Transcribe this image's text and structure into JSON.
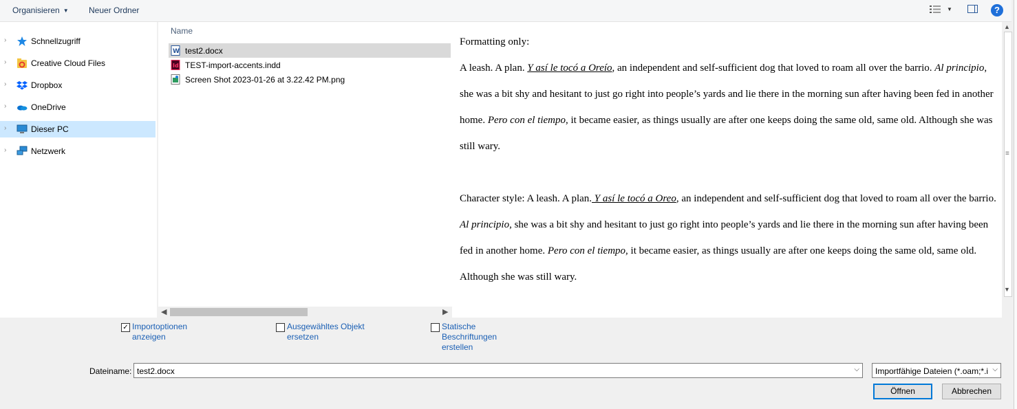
{
  "toolbar": {
    "organize_label": "Organisieren",
    "new_folder_label": "Neuer Ordner",
    "help_label": "?"
  },
  "nav": {
    "items": [
      {
        "label": "Schnellzugriff",
        "icon": "star-icon"
      },
      {
        "label": "Creative Cloud Files",
        "icon": "creative-cloud-icon"
      },
      {
        "label": "Dropbox",
        "icon": "dropbox-icon"
      },
      {
        "label": "OneDrive",
        "icon": "onedrive-icon"
      },
      {
        "label": "Dieser PC",
        "icon": "computer-icon",
        "selected": true
      },
      {
        "label": "Netzwerk",
        "icon": "network-icon"
      }
    ]
  },
  "filelist": {
    "column_name": "Name",
    "files": [
      {
        "name": "test2.docx",
        "icon": "word-doc-icon",
        "selected": true
      },
      {
        "name": "TEST-import-accents.indd",
        "icon": "indesign-file-icon"
      },
      {
        "name": "Screen Shot 2023-01-26 at 3.22.42 PM.png",
        "icon": "png-image-icon"
      }
    ]
  },
  "preview": {
    "heading": "Formatting only:",
    "p1": {
      "a": "A leash. A plan. ",
      "b": "Y así le tocó a Oreío",
      "c": ", an independent and self-sufficient dog that loved to roam all over the barrio. ",
      "d": "Al principio",
      "e": ", she was a bit shy and hesitant to just go right into people’s yards and lie there in the morning sun after having been fed in another home. ",
      "f": "Pero con el tiempo",
      "g": ", it became easier, as things usually are after one keeps doing the same old, same old. Although she was still wary."
    },
    "p2": {
      "a": "Character style: A leash. A plan.",
      "b": " Y así le tocó a Oreo",
      "c": ", an independent and self-sufficient dog that loved to roam all over the barrio. ",
      "d": "Al principio",
      "e": ", she was a bit shy and hesitant to just go right into people’s yards and lie there in the morning sun after having been fed in another home. ",
      "f": "Pero con el tiempo",
      "g": ", it became easier, as things usually are after one keeps doing the same old, same old. Although she was still wary."
    }
  },
  "options": {
    "import_options": {
      "label": "Importoptionen\nanzeigen",
      "checked": true,
      "mark": "✓"
    },
    "replace_selected": {
      "label": "Ausgewähltes Objekt\nersetzen",
      "checked": false
    },
    "static_captions": {
      "label": "Statische\nBeschriftungen\nerstellen",
      "checked": false
    }
  },
  "filename": {
    "label": "Dateiname:",
    "value": "test2.docx"
  },
  "filetype": {
    "selected": "Importfähige Dateien (*.oam;*.i"
  },
  "buttons": {
    "open": "Öffnen",
    "cancel": "Abbrechen"
  }
}
